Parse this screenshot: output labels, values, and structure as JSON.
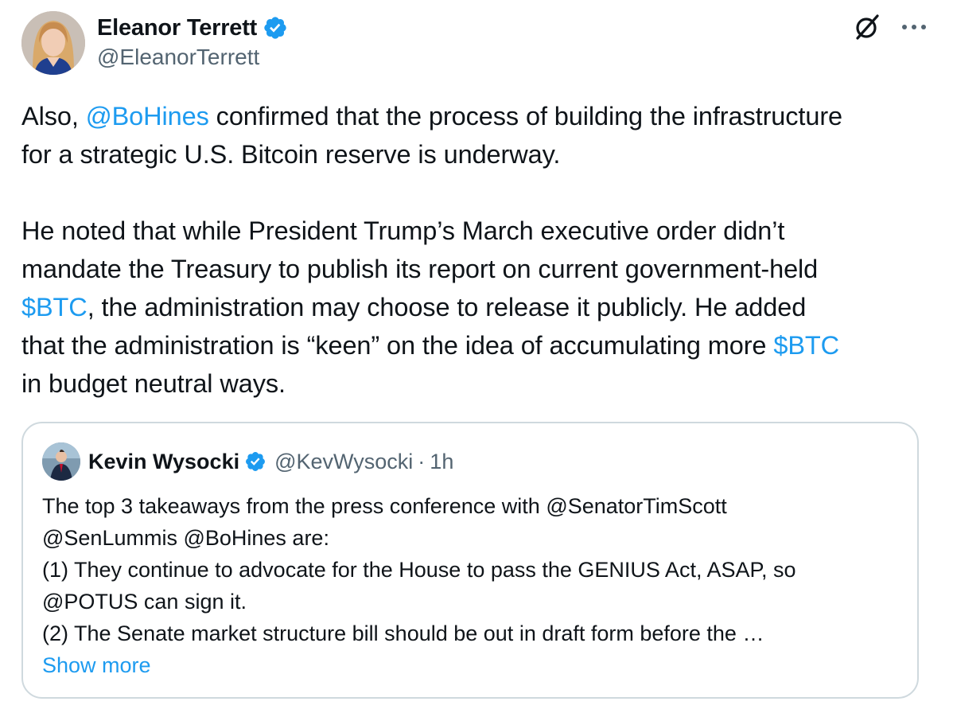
{
  "author": {
    "name": "Eleanor Terrett",
    "handle": "@EleanorTerrett"
  },
  "icons": {
    "verified": "verified-badge-icon",
    "grok": "grok-icon",
    "more": "more-options-icon"
  },
  "colors": {
    "link": "#1d9bf0",
    "text": "#0f1419",
    "secondary": "#536471",
    "border": "#cfd9de"
  },
  "tweet": {
    "p1_a": "Also, ",
    "p1_mention": "@BoHines",
    "p1_b": " confirmed that the process of building the infrastructure",
    "p1_line2": "for a strategic U.S. Bitcoin reserve is underway.",
    "p2_line1": "He noted that while President Trump’s March executive order didn’t",
    "p2_line2": "mandate the Treasury to publish its report on current government-held",
    "p2_cashtag1": "$BTC",
    "p2_line3_rest": ", the administration may choose to release it publicly. He added",
    "p2_line4": "that the administration is “keen” on the idea of accumulating more ",
    "p2_cashtag2": "$BTC",
    "p2_line5": "in budget neutral ways."
  },
  "quote": {
    "name": "Kevin Wysocki",
    "handle": "@KevWysocki",
    "dot": "·",
    "time": "1h",
    "lines": [
      "The top 3 takeaways from the press conference with @SenatorTimScott",
      "@SenLummis @BoHines are:",
      "(1) They continue to advocate for the House to pass the GENIUS Act, ASAP, so",
      "@POTUS can sign it.",
      "(2) The Senate market structure bill should be out in draft form before the …"
    ],
    "show_more": "Show more"
  }
}
